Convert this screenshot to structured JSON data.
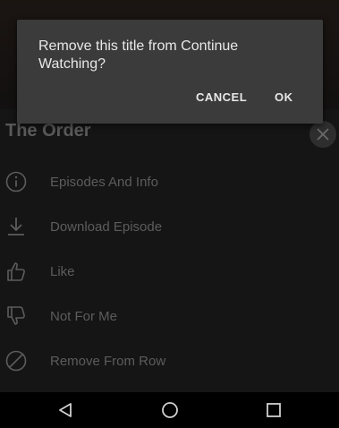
{
  "dialog": {
    "message": "Remove this title from Continue Watching?",
    "cancel_label": "CANCEL",
    "ok_label": "OK"
  },
  "sheet": {
    "title": "The Order",
    "items": [
      {
        "label": "Episodes And Info",
        "icon": "info-icon"
      },
      {
        "label": "Download Episode",
        "icon": "download-icon"
      },
      {
        "label": "Like",
        "icon": "thumbs-up-icon"
      },
      {
        "label": "Not For Me",
        "icon": "thumbs-down-icon"
      },
      {
        "label": "Remove From Row",
        "icon": "block-icon"
      }
    ]
  },
  "navbar": {
    "buttons": [
      "back-icon",
      "home-icon",
      "recents-icon"
    ]
  },
  "colors": {
    "dialog_bg": "#3b3b3b",
    "dialog_text": "#e8e8e8",
    "dimmed_text": "#5c5c5c",
    "navbar_bg": "#000000"
  }
}
